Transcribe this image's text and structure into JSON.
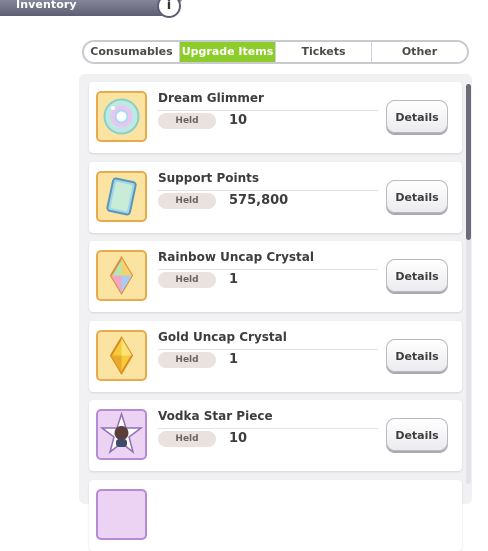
{
  "header": {
    "title": "Inventory",
    "info_label": "i"
  },
  "tabs": [
    {
      "label": "Consumables",
      "active": false
    },
    {
      "label": "Upgrade Items",
      "active": true
    },
    {
      "label": "Tickets",
      "active": false
    },
    {
      "label": "Other",
      "active": false
    }
  ],
  "colors": {
    "active_tab": "#8ccd2c",
    "header": "#6e6e82",
    "list_bg": "#f1f1f3"
  },
  "items": [
    {
      "name": "Dream Glimmer",
      "held_label": "Held",
      "held_value": "10",
      "details_label": "Details",
      "icon": "dream-glimmer-icon"
    },
    {
      "name": "Support Points",
      "held_label": "Held",
      "held_value": "575,800",
      "details_label": "Details",
      "icon": "support-points-icon"
    },
    {
      "name": "Rainbow Uncap Crystal",
      "held_label": "Held",
      "held_value": "1",
      "details_label": "Details",
      "icon": "rainbow-crystal-icon"
    },
    {
      "name": "Gold Uncap Crystal",
      "held_label": "Held",
      "held_value": "1",
      "details_label": "Details",
      "icon": "gold-crystal-icon"
    },
    {
      "name": "Vodka Star Piece",
      "held_label": "Held",
      "held_value": "10",
      "details_label": "Details",
      "icon": "star-piece-icon"
    }
  ]
}
